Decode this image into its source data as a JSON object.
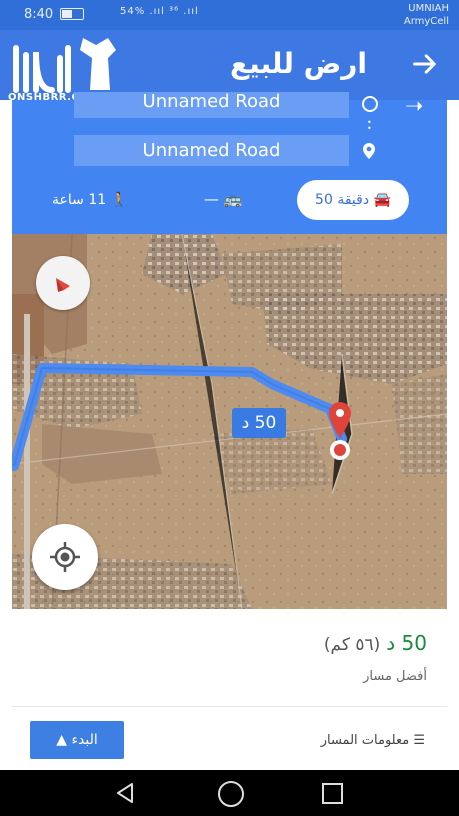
{
  "status_bar": {
    "time": "8:40",
    "carrier_line1": "UMNIAH",
    "carrier_line2": "ArmyCell",
    "signal": "54% .ııl ³⁶ .ııl"
  },
  "watermark": {
    "text": "ONSHBRR.COM"
  },
  "app_bar": {
    "title": "ارض للبيع",
    "back_icon": "arrow-right-icon"
  },
  "directions": {
    "origin": "Unnamed Road",
    "destination": "Unnamed Road",
    "modes": {
      "walk": "11 ساعة",
      "transit": "—",
      "car": "50 دقيقة"
    }
  },
  "map": {
    "eta_bubble": "50 د",
    "accent": "#3e7fe4"
  },
  "summary": {
    "eta": "50 د",
    "distance": "(٥٦ كم)",
    "best_route": "أفضل مسار"
  },
  "actions": {
    "start_label": "البدء",
    "route_info_label": "معلومات المسار"
  }
}
